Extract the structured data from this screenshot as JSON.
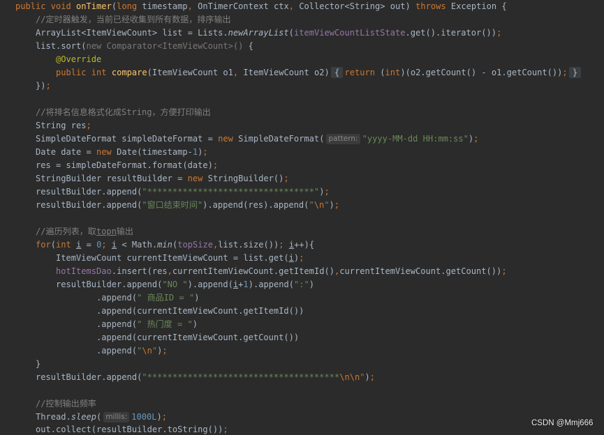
{
  "editor": {
    "background": "#2b2b2b",
    "foreground": "#a9b7c6",
    "lines": [
      [
        {
          "text": "public void ",
          "color": "#cc7832"
        },
        {
          "text": "onTimer",
          "color": "#ffc66d"
        },
        {
          "text": "(",
          "color": "#a9b7c6"
        },
        {
          "text": "long",
          "color": "#cc7832"
        },
        {
          "text": " timestamp",
          "color": "#a9b7c6"
        },
        {
          "text": ",",
          "color": "#cc7832"
        },
        {
          "text": " OnTimerContext ctx",
          "color": "#a9b7c6"
        },
        {
          "text": ",",
          "color": "#cc7832"
        },
        {
          "text": " Collector<String> out) ",
          "color": "#a9b7c6"
        },
        {
          "text": "throws",
          "color": "#cc7832"
        },
        {
          "text": " Exception {",
          "color": "#a9b7c6"
        }
      ],
      [
        {
          "text": "    //定时器触发，当前已经收集到所有数据，排序输出",
          "color": "#808080"
        }
      ],
      [
        {
          "text": "    ArrayList<ItemViewCount> list = Lists.",
          "color": "#a9b7c6"
        },
        {
          "text": "newArrayList",
          "color": "#a9b7c6",
          "italic": true
        },
        {
          "text": "(",
          "color": "#a9b7c6"
        },
        {
          "text": "itemViewCountListState",
          "color": "#9876aa"
        },
        {
          "text": ".get().iterator())",
          "color": "#a9b7c6"
        },
        {
          "text": ";",
          "color": "#cc7832"
        }
      ],
      [
        {
          "text": "    list.sort(",
          "color": "#a9b7c6"
        },
        {
          "text": "new Comparator<ItemViewCount>()",
          "color": "#787878"
        },
        {
          "text": " {",
          "color": "#a9b7c6"
        }
      ],
      [
        {
          "text": "        @Override",
          "color": "#bbb529"
        }
      ],
      [
        {
          "text": "        public int ",
          "color": "#cc7832"
        },
        {
          "text": "compare",
          "color": "#ffc66d"
        },
        {
          "text": "(ItemViewCount o1",
          "color": "#a9b7c6"
        },
        {
          "text": ",",
          "color": "#cc7832"
        },
        {
          "text": " ItemViewCount o2) ",
          "color": "#a9b7c6"
        },
        {
          "text": "{",
          "color": "#a9b7c6",
          "fold": true
        },
        {
          "text": " return",
          "color": "#cc7832"
        },
        {
          "text": " (",
          "color": "#a9b7c6"
        },
        {
          "text": "int",
          "color": "#cc7832"
        },
        {
          "text": ")(o2.getCount() - o1.getCount())",
          "color": "#a9b7c6"
        },
        {
          "text": "; ",
          "color": "#cc7832"
        },
        {
          "text": "}",
          "color": "#a9b7c6",
          "fold": true
        }
      ],
      [
        {
          "text": "    })",
          "color": "#a9b7c6"
        },
        {
          "text": ";",
          "color": "#cc7832"
        }
      ],
      [],
      [
        {
          "text": "    //将排名信息格式化成String，方便打印输出",
          "color": "#808080"
        }
      ],
      [
        {
          "text": "    String res",
          "color": "#a9b7c6"
        },
        {
          "text": ";",
          "color": "#cc7832"
        }
      ],
      [
        {
          "text": "    SimpleDateFormat simpleDateFormat = ",
          "color": "#a9b7c6"
        },
        {
          "text": "new",
          "color": "#cc7832"
        },
        {
          "text": " SimpleDateFormat(",
          "color": "#a9b7c6"
        },
        {
          "text": "pattern:",
          "color": "#8a8a8a",
          "hint": true
        },
        {
          "text": "\"yyyy-MM-dd HH:mm:ss\"",
          "color": "#6a8759"
        },
        {
          "text": ")",
          "color": "#a9b7c6"
        },
        {
          "text": ";",
          "color": "#cc7832"
        }
      ],
      [
        {
          "text": "    Date date = ",
          "color": "#a9b7c6"
        },
        {
          "text": "new",
          "color": "#cc7832"
        },
        {
          "text": " Date(timestamp-",
          "color": "#a9b7c6"
        },
        {
          "text": "1",
          "color": "#6897bb"
        },
        {
          "text": ")",
          "color": "#a9b7c6"
        },
        {
          "text": ";",
          "color": "#cc7832"
        }
      ],
      [
        {
          "text": "    res = simpleDateFormat.format(date)",
          "color": "#a9b7c6"
        },
        {
          "text": ";",
          "color": "#cc7832"
        }
      ],
      [
        {
          "text": "    StringBuilder resultBuilder = ",
          "color": "#a9b7c6"
        },
        {
          "text": "new",
          "color": "#cc7832"
        },
        {
          "text": " StringBuilder()",
          "color": "#a9b7c6"
        },
        {
          "text": ";",
          "color": "#cc7832"
        }
      ],
      [
        {
          "text": "    resultBuilder.append(",
          "color": "#a9b7c6"
        },
        {
          "text": "\"*********************************\"",
          "color": "#6a8759"
        },
        {
          "text": ")",
          "color": "#a9b7c6"
        },
        {
          "text": ";",
          "color": "#cc7832"
        }
      ],
      [
        {
          "text": "    resultBuilder.append(",
          "color": "#a9b7c6"
        },
        {
          "text": "\"窗口结束时间\"",
          "color": "#6a8759"
        },
        {
          "text": ").append(res).append(",
          "color": "#a9b7c6"
        },
        {
          "text": "\"",
          "color": "#6a8759"
        },
        {
          "text": "\\n",
          "color": "#cc7832"
        },
        {
          "text": "\"",
          "color": "#6a8759"
        },
        {
          "text": ")",
          "color": "#a9b7c6"
        },
        {
          "text": ";",
          "color": "#cc7832"
        }
      ],
      [],
      [
        {
          "text": "    //遍历列表，取",
          "color": "#808080"
        },
        {
          "text": "topn",
          "color": "#808080",
          "underline": true
        },
        {
          "text": "输出",
          "color": "#808080"
        }
      ],
      [
        {
          "text": "    for",
          "color": "#cc7832"
        },
        {
          "text": "(",
          "color": "#a9b7c6"
        },
        {
          "text": "int ",
          "color": "#cc7832"
        },
        {
          "text": "i",
          "color": "#a9b7c6",
          "underline": true
        },
        {
          "text": " = ",
          "color": "#a9b7c6"
        },
        {
          "text": "0",
          "color": "#6897bb"
        },
        {
          "text": "; ",
          "color": "#cc7832"
        },
        {
          "text": "i",
          "color": "#a9b7c6",
          "underline": true
        },
        {
          "text": " < Math.",
          "color": "#a9b7c6"
        },
        {
          "text": "min",
          "color": "#a9b7c6",
          "italic": true
        },
        {
          "text": "(",
          "color": "#a9b7c6"
        },
        {
          "text": "topSize",
          "color": "#9876aa"
        },
        {
          "text": ",",
          "color": "#cc7832"
        },
        {
          "text": "list.size())",
          "color": "#a9b7c6"
        },
        {
          "text": "; ",
          "color": "#cc7832"
        },
        {
          "text": "i",
          "color": "#a9b7c6",
          "underline": true
        },
        {
          "text": "++){",
          "color": "#a9b7c6"
        }
      ],
      [
        {
          "text": "        ItemViewCount currentItemViewCount = list.get(",
          "color": "#a9b7c6"
        },
        {
          "text": "i",
          "color": "#a9b7c6",
          "underline": true
        },
        {
          "text": ")",
          "color": "#a9b7c6"
        },
        {
          "text": ";",
          "color": "#cc7832"
        }
      ],
      [
        {
          "text": "        hotItemsDao",
          "color": "#9876aa"
        },
        {
          "text": ".insert(res",
          "color": "#a9b7c6"
        },
        {
          "text": ",",
          "color": "#cc7832"
        },
        {
          "text": "currentItemViewCount.getItemId()",
          "color": "#a9b7c6"
        },
        {
          "text": ",",
          "color": "#cc7832"
        },
        {
          "text": "currentItemViewCount.getCount())",
          "color": "#a9b7c6"
        },
        {
          "text": ";",
          "color": "#cc7832"
        }
      ],
      [
        {
          "text": "        resultBuilder.append(",
          "color": "#a9b7c6"
        },
        {
          "text": "\"NO \"",
          "color": "#6a8759"
        },
        {
          "text": ").append(",
          "color": "#a9b7c6"
        },
        {
          "text": "i",
          "color": "#a9b7c6",
          "underline": true
        },
        {
          "text": "+",
          "color": "#a9b7c6"
        },
        {
          "text": "1",
          "color": "#6897bb"
        },
        {
          "text": ").append(",
          "color": "#a9b7c6"
        },
        {
          "text": "\":\"",
          "color": "#6a8759"
        },
        {
          "text": ")",
          "color": "#a9b7c6"
        }
      ],
      [
        {
          "text": "                .append(",
          "color": "#a9b7c6"
        },
        {
          "text": "\" 商品ID = \"",
          "color": "#6a8759"
        },
        {
          "text": ")",
          "color": "#a9b7c6"
        }
      ],
      [
        {
          "text": "                .append(currentItemViewCount.getItemId())",
          "color": "#a9b7c6"
        }
      ],
      [
        {
          "text": "                .append(",
          "color": "#a9b7c6"
        },
        {
          "text": "\" 热门度 = \"",
          "color": "#6a8759"
        },
        {
          "text": ")",
          "color": "#a9b7c6"
        }
      ],
      [
        {
          "text": "                .append(currentItemViewCount.getCount())",
          "color": "#a9b7c6"
        }
      ],
      [
        {
          "text": "                .append(",
          "color": "#a9b7c6"
        },
        {
          "text": "\"",
          "color": "#6a8759"
        },
        {
          "text": "\\n",
          "color": "#cc7832"
        },
        {
          "text": "\"",
          "color": "#6a8759"
        },
        {
          "text": ")",
          "color": "#a9b7c6"
        },
        {
          "text": ";",
          "color": "#cc7832"
        }
      ],
      [
        {
          "text": "    }",
          "color": "#a9b7c6"
        }
      ],
      [
        {
          "text": "    resultBuilder.append(",
          "color": "#a9b7c6"
        },
        {
          "text": "\"**************************************",
          "color": "#6a8759"
        },
        {
          "text": "\\n\\n",
          "color": "#cc7832"
        },
        {
          "text": "\"",
          "color": "#6a8759"
        },
        {
          "text": ")",
          "color": "#a9b7c6"
        },
        {
          "text": ";",
          "color": "#cc7832"
        }
      ],
      [],
      [
        {
          "text": "    //控制输出频率",
          "color": "#808080"
        }
      ],
      [
        {
          "text": "    Thread.",
          "color": "#a9b7c6"
        },
        {
          "text": "sleep",
          "color": "#a9b7c6",
          "italic": true
        },
        {
          "text": "(",
          "color": "#a9b7c6"
        },
        {
          "text": "millis:",
          "color": "#8a8a8a",
          "hint": true
        },
        {
          "text": "1000L",
          "color": "#6897bb"
        },
        {
          "text": ")",
          "color": "#a9b7c6"
        },
        {
          "text": ";",
          "color": "#cc7832"
        }
      ],
      [
        {
          "text": "    out.collect(resultBuilder.toString())",
          "color": "#a9b7c6"
        },
        {
          "text": ";",
          "color": "#cc7832"
        }
      ]
    ]
  },
  "watermark": "CSDN @Mmj666"
}
